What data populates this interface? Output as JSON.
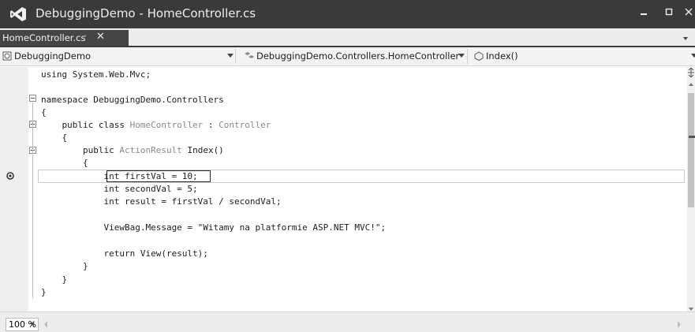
{
  "window": {
    "title": "DebuggingDemo - HomeController.cs"
  },
  "tabs": [
    {
      "label": "HomeController.cs",
      "pin_icon": "pin-icon",
      "close_label": "✕"
    }
  ],
  "nav": {
    "project": "DebuggingDemo",
    "class": "DebuggingDemo.Controllers.HomeController",
    "member": "Index()"
  },
  "code": {
    "lines": [
      "using System.Web.Mvc;",
      "",
      "namespace DebuggingDemo.Controllers",
      "{",
      "    public class ",
      "    {",
      "        public ",
      "        {",
      "            int firstVal = 10;",
      "            int secondVal = 5;",
      "            int result = firstVal / secondVal;",
      "",
      "            ViewBag.Message = \"Witamy na platformie ASP.NET MVC!\";",
      "",
      "            return View(result);",
      "        }",
      "    }",
      "}"
    ],
    "class_name": "HomeController",
    "class_sep": " : ",
    "base_class": "Controller",
    "return_type": "ActionResult",
    "method_sig": " Index()"
  },
  "status": {
    "zoom": "100 %"
  },
  "colors": {
    "titlebar": "#3a3a3a",
    "tab_active": "#454545",
    "type_name": "#8a8a8a",
    "vs_logo": "#f2f2f2"
  }
}
